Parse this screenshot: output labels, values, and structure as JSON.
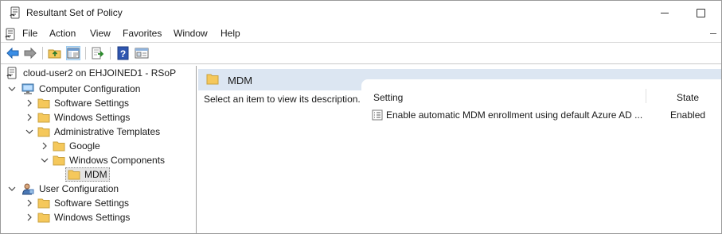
{
  "window": {
    "title": "Resultant Set of Policy"
  },
  "menu": {
    "items": [
      "File",
      "Action",
      "View",
      "Favorites",
      "Window",
      "Help"
    ]
  },
  "toolbar": {
    "buttons": [
      "back-arrow-icon",
      "forward-arrow-icon",
      "up-folder-icon",
      "show-hide-tree-icon",
      "export-list-icon",
      "help-icon",
      "properties-icon"
    ]
  },
  "tree": {
    "root": "cloud-user2 on EHJOINED1 - RSoP",
    "computer_config": "Computer Configuration",
    "software_settings": "Software Settings",
    "windows_settings": "Windows Settings",
    "admin_templates": "Administrative Templates",
    "google": "Google",
    "windows_components": "Windows Components",
    "mdm": "MDM",
    "user_config": "User Configuration",
    "user_software_settings": "Software Settings",
    "user_windows_settings": "Windows Settings"
  },
  "details": {
    "header": "MDM",
    "description": "Select an item to view its description.",
    "columns": {
      "setting": "Setting",
      "state": "State"
    },
    "rows": [
      {
        "setting": "Enable automatic MDM enrollment using default Azure AD ...",
        "state": "Enabled"
      }
    ]
  },
  "colors": {
    "header_band": "#dce6f2",
    "selection": "#e5e5e5",
    "folder": "#f5c85b"
  }
}
